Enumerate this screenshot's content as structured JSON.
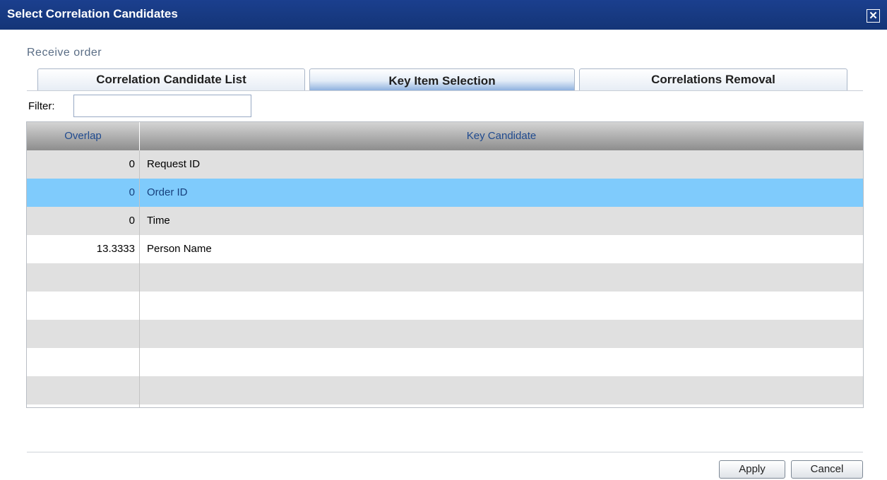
{
  "window": {
    "title": "Select Correlation Candidates",
    "close_glyph": "✕"
  },
  "section_label": "Receive order",
  "tabs": [
    {
      "label": "Correlation Candidate List",
      "active": false
    },
    {
      "label": "Key Item Selection",
      "active": true
    },
    {
      "label": "Correlations Removal",
      "active": false
    }
  ],
  "filter": {
    "label": "Filter:",
    "value": "",
    "placeholder": ""
  },
  "table": {
    "columns": [
      "Overlap",
      "Key Candidate"
    ],
    "rows": [
      {
        "overlap": "0",
        "key": "Request ID",
        "selected": false
      },
      {
        "overlap": "0",
        "key": "Order ID",
        "selected": true
      },
      {
        "overlap": "0",
        "key": "Time",
        "selected": false
      },
      {
        "overlap": "13.3333",
        "key": "Person Name",
        "selected": false
      },
      {
        "overlap": "",
        "key": "",
        "selected": false
      },
      {
        "overlap": "",
        "key": "",
        "selected": false
      },
      {
        "overlap": "",
        "key": "",
        "selected": false
      },
      {
        "overlap": "",
        "key": "",
        "selected": false
      },
      {
        "overlap": "",
        "key": "",
        "selected": false
      }
    ]
  },
  "buttons": {
    "apply": "Apply",
    "cancel": "Cancel"
  },
  "colors": {
    "titlebar": "#143577",
    "selected_row": "#7fcbfc",
    "header_text": "#1f4a8f"
  }
}
